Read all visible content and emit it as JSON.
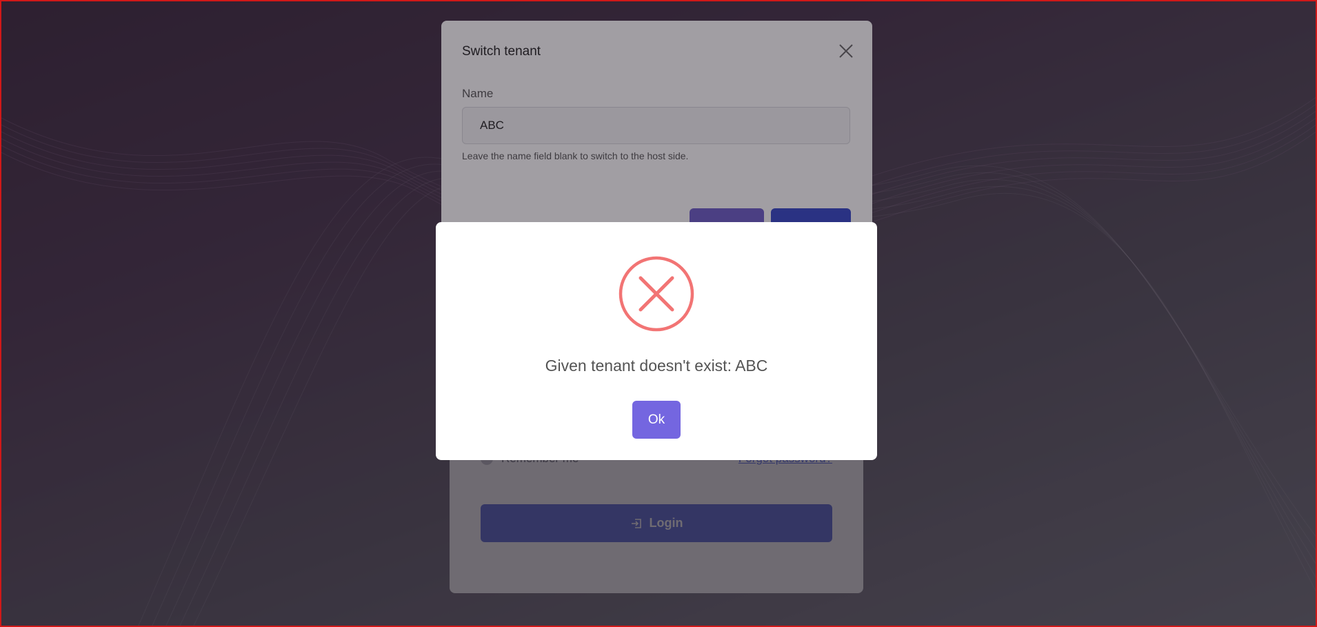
{
  "login": {
    "remember_label": "Remember me",
    "forgot_label": "Forgot password?",
    "login_label": "Login"
  },
  "tenant_modal": {
    "title": "Switch tenant",
    "name_label": "Name",
    "name_value": "ABC",
    "hint": "Leave the name field blank to switch to the host side."
  },
  "alert": {
    "message": "Given tenant doesn't exist: ABC",
    "ok_label": "Ok",
    "icon": "error-x-icon",
    "icon_color": "#f27474"
  },
  "colors": {
    "accent": "#7466e0",
    "primary": "#3346c8",
    "login_button": "#5d6dd8"
  }
}
